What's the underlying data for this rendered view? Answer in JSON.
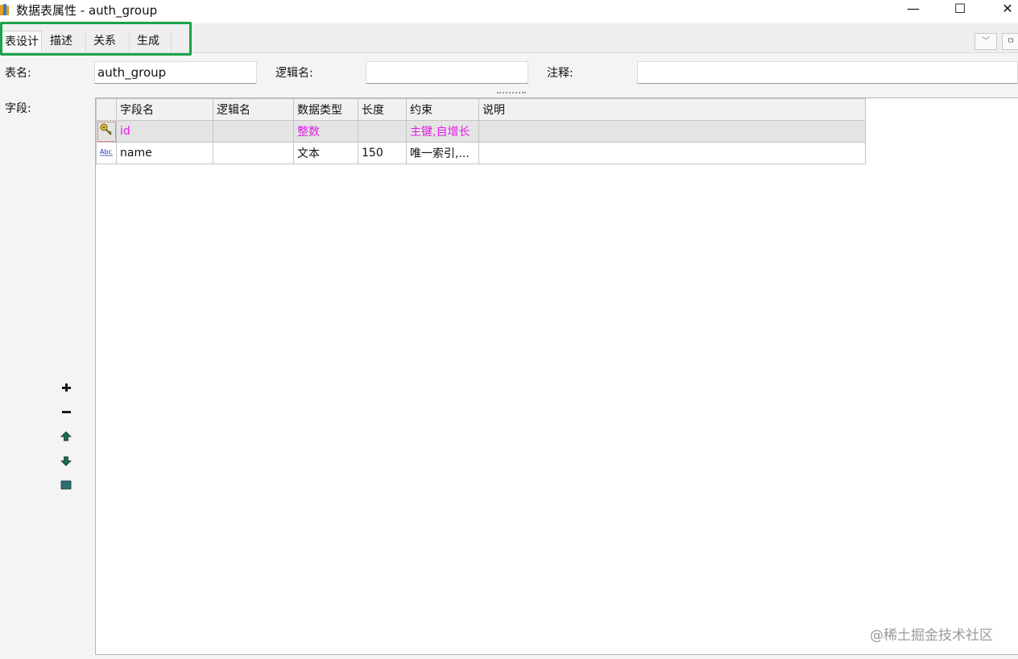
{
  "window": {
    "title": "数据表属性 - auth_group",
    "minimize": "—",
    "maximize": "☐",
    "close": "✕"
  },
  "tabs": [
    {
      "label": "表设计",
      "active": true
    },
    {
      "label": "描述"
    },
    {
      "label": "关系"
    },
    {
      "label": "生成"
    }
  ],
  "tab_controls": {
    "dropdown_icon": "﹀",
    "pin_icon": "ㅁ"
  },
  "form": {
    "table_name_label": "表名:",
    "table_name_value": "auth_group",
    "logical_name_label": "逻辑名:",
    "logical_name_value": "",
    "comment_label": "注释:",
    "comment_value": "",
    "fields_label": "字段:"
  },
  "grid": {
    "columns": [
      "字段名",
      "逻辑名",
      "数据类型",
      "长度",
      "约束",
      "说明"
    ],
    "rows": [
      {
        "icon": "key-icon",
        "cells": [
          "id",
          "",
          "整数",
          "",
          "主键,自增长",
          ""
        ],
        "selected": true
      },
      {
        "icon": "text-type-icon",
        "cells": [
          "name",
          "",
          "文本",
          "150",
          "唯一索引,...",
          ""
        ],
        "selected": false
      }
    ]
  },
  "side_toolbar": [
    "add-field-icon",
    "remove-field-icon",
    "move-up-icon",
    "move-down-icon",
    "table-icon"
  ],
  "colors": {
    "highlight_box": "#1aa34a",
    "selected_text": "#e31ce3"
  },
  "watermark": "@稀土掘金技术社区"
}
